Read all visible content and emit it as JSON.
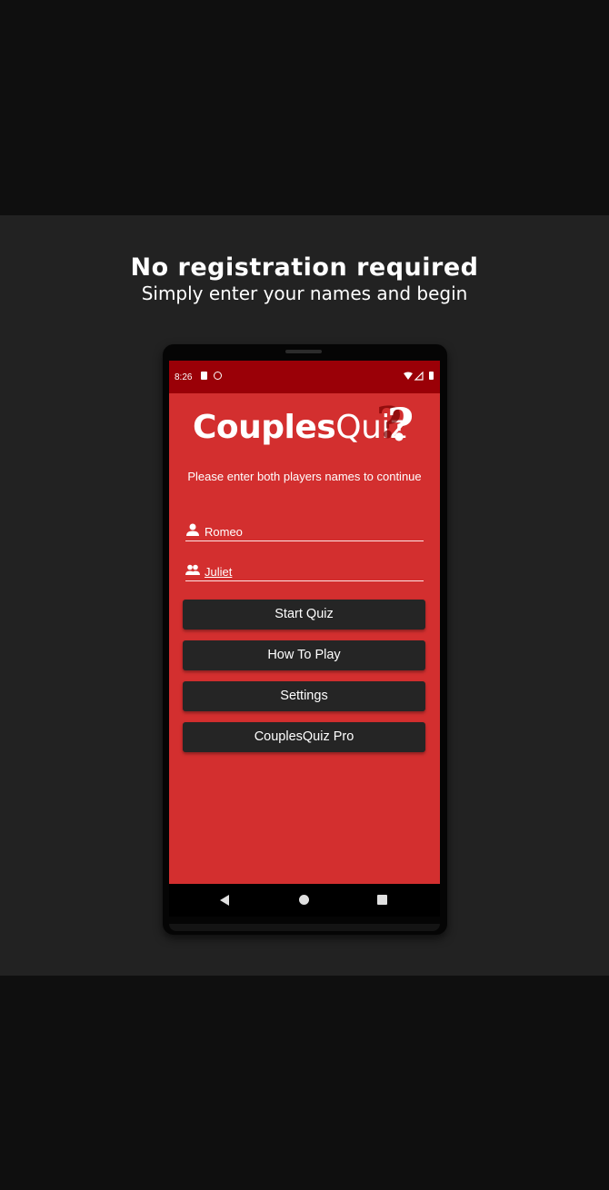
{
  "banner": {
    "headline": "No registration required",
    "subline": "Simply enter your names and begin"
  },
  "status_bar": {
    "time": "8:26",
    "icons": [
      "sd-card-icon",
      "sync-icon",
      "wifi-icon",
      "signal-icon",
      "battery-icon"
    ]
  },
  "app": {
    "logo_part1": "Couples",
    "logo_part2": "Quiz",
    "logo_mark": "?",
    "prompt": "Please enter both players names to continue",
    "player1": {
      "value": "Romeo",
      "icon": "person-icon"
    },
    "player2": {
      "value": "Juliet",
      "icon": "people-icon"
    },
    "buttons": {
      "start": "Start Quiz",
      "how_to_play": "How To Play",
      "settings": "Settings",
      "pro": "CouplesQuiz Pro"
    }
  },
  "colors": {
    "background": "#0f0f0f",
    "band": "#222222",
    "app_background": "#d32f2f",
    "status_bar": "#9a0007",
    "button": "#252525"
  },
  "nav_bar": {
    "icons": [
      "back-icon",
      "home-icon",
      "recents-icon"
    ]
  }
}
